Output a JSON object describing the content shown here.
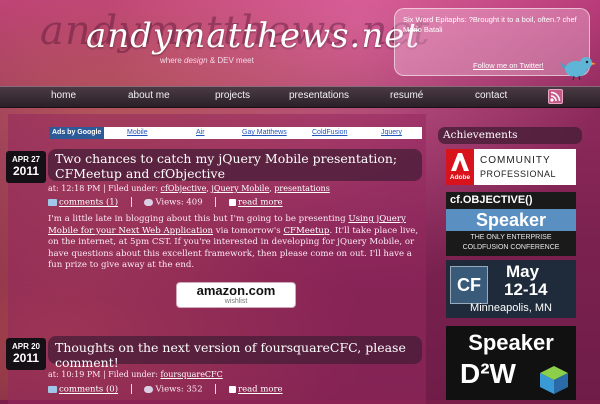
{
  "site": {
    "logo_background": "andymatthews.net",
    "logo": "andymatthews.net",
    "tagline_pre": "where ",
    "tagline_design": "design",
    "tagline_post": " & DEV meet"
  },
  "twitter": {
    "status": "Six Word Epitaphs: ?Brought it to a boil, often.? chef Mario Batali",
    "follow_label": "Follow me on Twitter!"
  },
  "nav": {
    "items": [
      {
        "label": "home"
      },
      {
        "label": "about me"
      },
      {
        "label": "projects"
      },
      {
        "label": "presentations"
      },
      {
        "label": "resumé"
      },
      {
        "label": "contact"
      }
    ],
    "rss_icon": "rss-icon"
  },
  "ads": {
    "label": "Ads by Google",
    "links": [
      "Mobile",
      "Air",
      "Gay Matthews",
      "ColdFusion",
      "Jquery"
    ]
  },
  "posts": [
    {
      "month_day": "APR 27",
      "year": "2011",
      "title": "Two chances to catch my jQuery Mobile presentation; CFMeetup and cfObjective",
      "meta_prefix": "at: 12:18 PM | Filed under: ",
      "categories": [
        "cfObjective",
        "jQuery Mobile",
        "presentations"
      ],
      "comments": "comments (1)",
      "views": "Views: 409",
      "read_more": "read more",
      "body_1": "I'm a little late in blogging about this but I'm going to be presenting ",
      "body_link_1": "Using jQuery Mobile for your Next Web Application",
      "body_2": " via tomorrow's ",
      "body_link_2": "CFMeetup",
      "body_3": ". It'll take place live, on the internet, at 5pm CST. If you're interested in developing for jQuery Mobile, or have questions about this excellent framework, then please come on out. I'll have a fun prize to give away at the end."
    },
    {
      "month_day": "APR 20",
      "year": "2011",
      "title": "Thoughts on the next version of foursquareCFC, please comment!",
      "meta_prefix": "at: 10:19 PM | Filed under: ",
      "categories": [
        "foursquareCFC"
      ],
      "comments": "comments (0)",
      "views": "Views: 352",
      "read_more": "read more"
    }
  ],
  "amazon": {
    "name": "amazon.com",
    "sub": "wishlist"
  },
  "sidebar": {
    "title": "Achievements",
    "badges": [
      {
        "top_text": "Adobe",
        "line1": "COMMUNITY",
        "line2": "PROFESSIONAL"
      },
      {
        "top_text": "cf.OBJECTIVE()",
        "line1": "Speaker",
        "line2": "THE ONLY ENTERPRISE",
        "line3": "COLDFUSION CONFERENCE"
      },
      {
        "top_text": "CF",
        "line1": "May",
        "line2": "12-14",
        "line3": "Minneapolis, MN"
      },
      {
        "top_text": "Speaker",
        "line1": "D²W"
      }
    ]
  }
}
